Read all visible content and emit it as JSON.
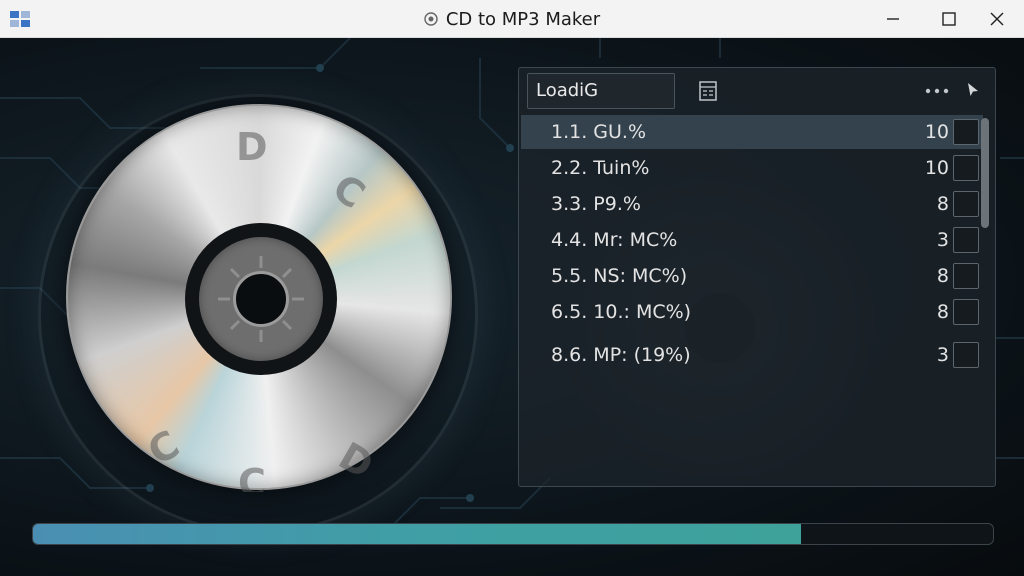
{
  "window": {
    "title": "CD to MP3 Maker",
    "title_icon": "disc-icon",
    "app_icon": "app-grid-icon",
    "controls": [
      "minimize-icon",
      "maximize-icon",
      "close-icon"
    ]
  },
  "disc": {
    "icon": "cd-disc",
    "letters": [
      "D",
      "C",
      "C",
      "C",
      "D"
    ]
  },
  "panel": {
    "status_text": "LoadiG",
    "header_icons": [
      "document-icon",
      "more-icon",
      "cursor-arrow-icon"
    ],
    "tracks": [
      {
        "label": "1.1.  GU.%",
        "num": "10",
        "selected": true
      },
      {
        "label": "2.2.  Tuin%",
        "num": "10",
        "selected": false
      },
      {
        "label": "3.3.  P9.%",
        "num": "8",
        "selected": false
      },
      {
        "label": "4.4.  Mr: MC%",
        "num": "3",
        "selected": false
      },
      {
        "label": "5.5.  NS: MC%)",
        "num": "8",
        "selected": false
      },
      {
        "label": "6.5.  10.: MC%)",
        "num": "8",
        "selected": false
      },
      {
        "label": "8.6.  MP: (19%)",
        "num": "3",
        "selected": false
      }
    ]
  },
  "progress": {
    "fraction": 0.8,
    "color": "#3f9fa5"
  },
  "colors": {
    "titlebar": "#f3f3f3",
    "background": "#0d161c",
    "panel": "#1c242a",
    "selected_row": "#34424d"
  }
}
